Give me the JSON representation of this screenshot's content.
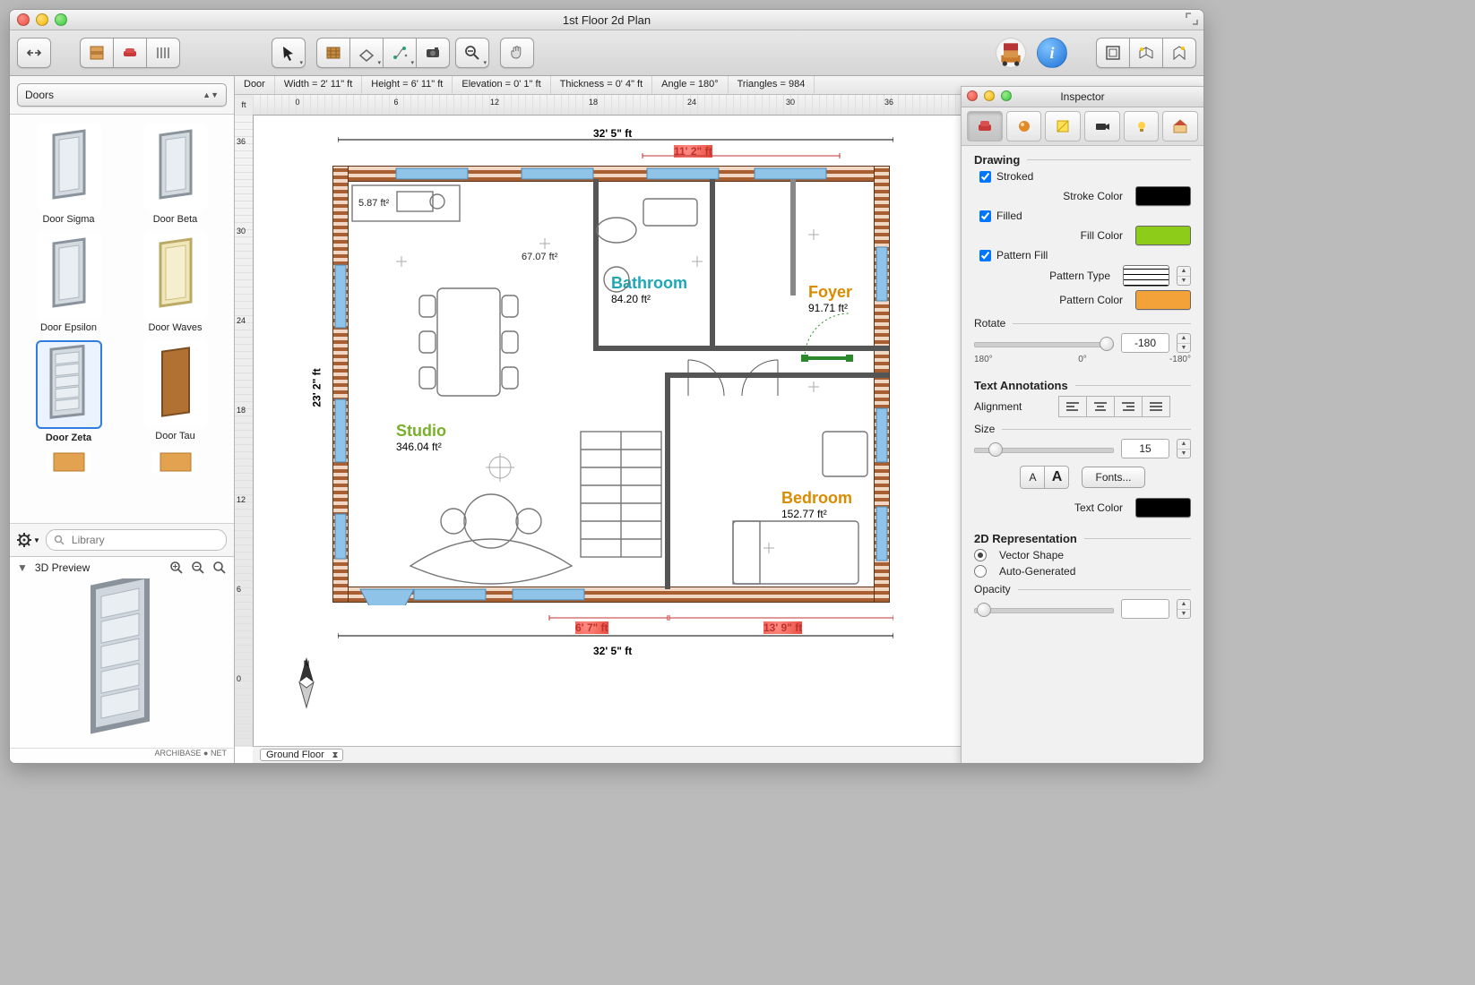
{
  "window": {
    "title": "1st Floor 2d Plan"
  },
  "toolbar": {
    "modes": [
      "walls",
      "furniture",
      "dimensions"
    ],
    "tools": [
      "select",
      "materials",
      "extrude",
      "paths",
      "camera",
      "zoom",
      "pan"
    ]
  },
  "statusbar": {
    "object": "Door",
    "width": "Width = 2' 11\" ft",
    "height": "Height = 6' 11\" ft",
    "elevation": "Elevation = 0' 1\" ft",
    "thickness": "Thickness = 0' 4\" ft",
    "angle": "Angle = 180°",
    "triangles": "Triangles = 984"
  },
  "ruler": {
    "unit": "ft",
    "hticks": [
      "0",
      "6",
      "12",
      "18",
      "24",
      "30",
      "36"
    ],
    "vticks": [
      "36",
      "30",
      "24",
      "18",
      "12",
      "6",
      "0"
    ]
  },
  "library": {
    "category": "Doors",
    "items": [
      {
        "label": "Door Sigma",
        "sel": false,
        "color": "#d3dae0",
        "acc": "#b8c1c9"
      },
      {
        "label": "Door Beta",
        "sel": false,
        "color": "#d3dae0",
        "acc": "#b8c1c9"
      },
      {
        "label": "Door Epsilon",
        "sel": false,
        "color": "#d3dae0",
        "acc": "#b8c1c9"
      },
      {
        "label": "Door Waves",
        "sel": false,
        "color": "#efe6b9",
        "acc": "#d8ca83"
      },
      {
        "label": "Door Zeta",
        "sel": true,
        "color": "#d3dae0",
        "acc": "#b8c1c9"
      },
      {
        "label": "Door Tau",
        "sel": false,
        "color": "#b07132",
        "acc": "#8d5a27"
      },
      {
        "label": "",
        "sel": false,
        "color": "#e2a24f",
        "acc": "#c88330"
      },
      {
        "label": "",
        "sel": false,
        "color": "#e2a24f",
        "acc": "#c88330"
      }
    ],
    "search_placeholder": "Library",
    "preview_title": "3D Preview",
    "brand": "ARCHIBASE ● NET"
  },
  "plan": {
    "floor_selector": "Ground Floor",
    "dimensions": {
      "outer_w_top": "32' 5\" ft",
      "outer_w_bottom": "32' 5\" ft",
      "height_left": "23' 2\" ft",
      "top_right_red": "11' 2\" ft",
      "bottom_left_red": "6' 7\" ft",
      "bottom_right_red": "13' 9\" ft"
    },
    "rooms": {
      "studio": {
        "label": "Studio",
        "area": "346.04 ft²"
      },
      "bathroom": {
        "label": "Bathroom",
        "area": "84.20 ft²"
      },
      "foyer": {
        "label": "Foyer",
        "area": "91.71 ft²"
      },
      "bedroom": {
        "label": "Bedroom",
        "area": "152.77 ft²"
      },
      "kitchen_area": "5.87 ft²",
      "closet_area": "67.07 ft²"
    }
  },
  "inspector": {
    "title": "Inspector",
    "drawing": {
      "title": "Drawing",
      "stroked_label": "Stroked",
      "strokecolor_label": "Stroke Color",
      "filled_label": "Filled",
      "fillcolor_label": "Fill Color",
      "patternfill_label": "Pattern Fill",
      "patterntype_label": "Pattern Type",
      "patterncolor_label": "Pattern Color",
      "rotate_label": "Rotate",
      "rotate_value": "-180",
      "rotate_min": "180°",
      "rotate_mid": "0°",
      "rotate_max": "-180°"
    },
    "text": {
      "title": "Text Annotations",
      "alignment_label": "Alignment",
      "size_label": "Size",
      "size_value": "15",
      "fonts_label": "Fonts...",
      "textcolor_label": "Text Color"
    },
    "rep": {
      "title": "2D Representation",
      "vector_label": "Vector Shape",
      "auto_label": "Auto-Generated",
      "opacity_label": "Opacity"
    }
  }
}
